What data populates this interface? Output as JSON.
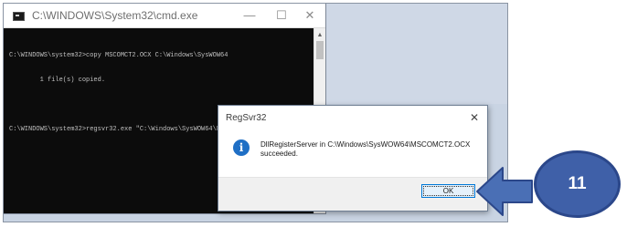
{
  "cmd": {
    "title": "C:\\WINDOWS\\System32\\cmd.exe",
    "controls": {
      "minimize": "—",
      "maximize": "☐",
      "close": "✕"
    },
    "lines": [
      "C:\\WINDOWS\\system32>copy MSCOMCT2.OCX C:\\Windows\\SysWOW64",
      "        1 file(s) copied.",
      "",
      "C:\\WINDOWS\\system32>regsvr32.exe \"C:\\Windows\\SysWOW64\\MSCOMCT2.OCX\""
    ],
    "scroll": {
      "up": "▲",
      "down": "▼"
    }
  },
  "dialog": {
    "title": "RegSvr32",
    "close": "✕",
    "icon_glyph": "i",
    "message": "DllRegisterServer in C:\\Windows\\SysWOW64\\MSCOMCT2.OCX succeeded.",
    "ok_label": "OK"
  },
  "callout": {
    "step": "11",
    "color": "#3f60a8"
  }
}
